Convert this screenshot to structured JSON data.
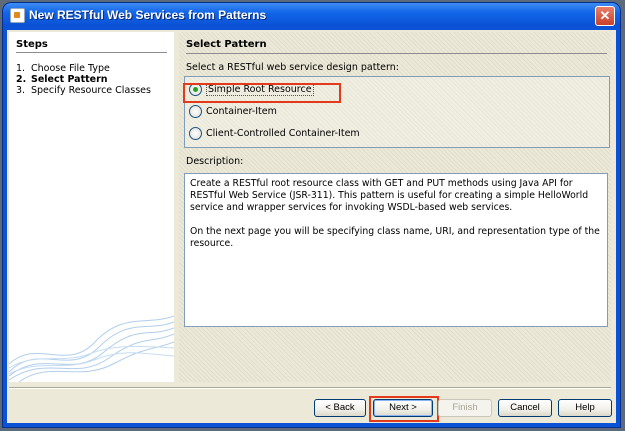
{
  "window": {
    "title": "New RESTful Web Services from Patterns",
    "close_glyph": "✕"
  },
  "steps": {
    "heading": "Steps",
    "items": [
      {
        "num": "1.",
        "label": "Choose File Type"
      },
      {
        "num": "2.",
        "label": "Select Pattern"
      },
      {
        "num": "3.",
        "label": "Specify Resource Classes"
      }
    ],
    "active_index": 1
  },
  "panel": {
    "title": "Select Pattern",
    "prompt": "Select a RESTful web service design pattern:",
    "options": [
      {
        "label": "Simple Root Resource",
        "checked": true
      },
      {
        "label": "Container-Item",
        "checked": false
      },
      {
        "label": "Client-Controlled Container-Item",
        "checked": false
      }
    ],
    "description_label": "Description:",
    "description_paragraphs": [
      "Create a RESTful root resource class with GET and PUT methods using Java API for RESTful Web Service (JSR-311). This pattern is useful for creating a simple HelloWorld service and wrapper services for invoking WSDL-based web services.",
      "On the next page you will be specifying class name, URI, and representation type of the resource."
    ]
  },
  "buttons": {
    "back": "< Back",
    "next": "Next >",
    "finish": "Finish",
    "cancel": "Cancel",
    "help": "Help"
  },
  "colors": {
    "highlight": "#e43a1c",
    "title_bar": "#0a53d6"
  }
}
